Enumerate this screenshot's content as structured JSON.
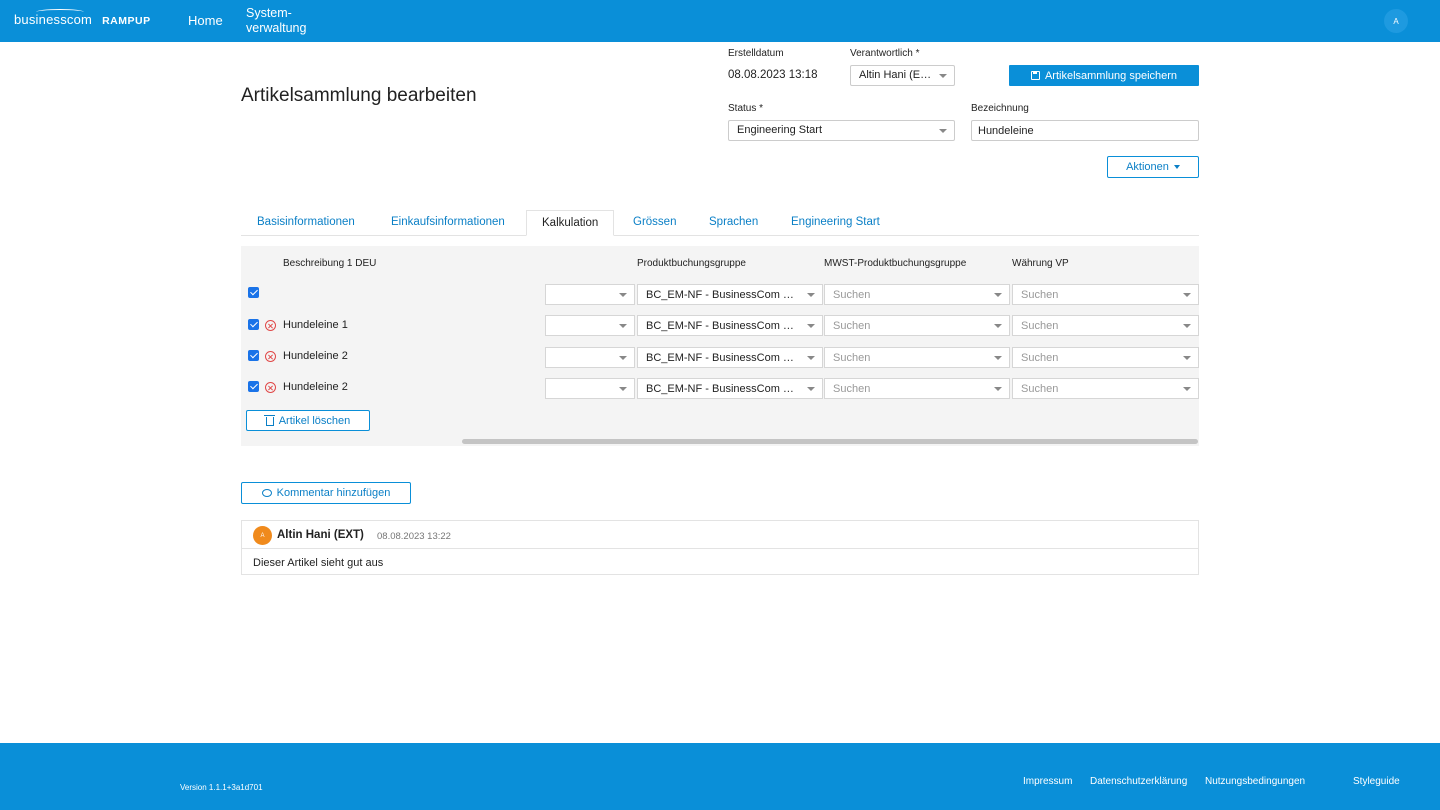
{
  "topbar": {
    "logo_word": "businesscom",
    "logo_product": "RAMPUP",
    "nav_home": "Home",
    "nav_system_line1": "System-",
    "nav_system_line2": "verwaltung",
    "avatar_initial": "A"
  },
  "header": {
    "title": "Artikelsammlung bearbeiten",
    "erstelldatum_label": "Erstelldatum",
    "erstelldatum_value": "08.08.2023 13:18",
    "verantwortlich_label": "Verantwortlich *",
    "verantwortlich_value": "Altin Hani (EXT)",
    "save_label": "Artikelsammlung speichern",
    "status_label": "Status *",
    "status_value": "Engineering Start",
    "bezeichnung_label": "Bezeichnung",
    "bezeichnung_value": "Hundeleine",
    "aktionen_label": "Aktionen"
  },
  "tabs": [
    {
      "label": "Basisinformationen"
    },
    {
      "label": "Einkaufsinformationen"
    },
    {
      "label": "Kalkulation"
    },
    {
      "label": "Grössen"
    },
    {
      "label": "Sprachen"
    },
    {
      "label": "Engineering Start"
    }
  ],
  "grid": {
    "headers": {
      "beschreibung": "Beschreibung 1 DEU",
      "produktbuchungsgruppe": "Produktbuchungsgruppe",
      "mwst": "MWST-Produktbuchungsgruppe",
      "waehrung": "Währung VP"
    },
    "rows": [
      {
        "name": "",
        "pbg": "BC_EM-NF - BusinessCom Einkauf",
        "mwst_placeholder": "Suchen",
        "waehrung_placeholder": "Suchen"
      },
      {
        "name": "Hundeleine 1",
        "pbg": "BC_EM-NF - BusinessCom Einkauf",
        "mwst_placeholder": "Suchen",
        "waehrung_placeholder": "Suchen"
      },
      {
        "name": "Hundeleine 2",
        "pbg": "BC_EM-NF - BusinessCom Einkauf",
        "mwst_placeholder": "Suchen",
        "waehrung_placeholder": "Suchen"
      },
      {
        "name": "Hundeleine 2",
        "pbg": "BC_EM-NF - BusinessCom Einkauf",
        "mwst_placeholder": "Suchen",
        "waehrung_placeholder": "Suchen"
      }
    ],
    "delete_label": "Artikel löschen"
  },
  "comments": {
    "add_label": "Kommentar hinzufügen",
    "items": [
      {
        "avatar": "A",
        "author": "Altin Hani (EXT)",
        "time": "08.08.2023 13:22",
        "text": "Dieser Artikel sieht gut aus"
      }
    ]
  },
  "footer": {
    "version": "Version 1.1.1+3a1d701",
    "links": [
      "Impressum",
      "Datenschutzerklärung",
      "Nutzungsbedingungen",
      "Styleguide"
    ]
  },
  "colors": {
    "brand": "#0a8fd8",
    "link": "#0a7fc6",
    "checkbox": "#1a73e8",
    "remove": "#e04848",
    "comment_avatar": "#f08a1c"
  }
}
